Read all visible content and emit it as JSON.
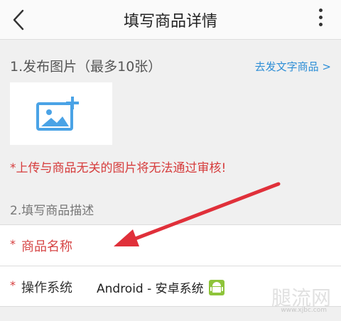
{
  "header": {
    "title": "填写商品详情"
  },
  "section_photos": {
    "label": "1.发布图片（最多10张）",
    "text_link": "去发文字商品 >",
    "warning": "*上传与商品无关的图片将无法通过审核!"
  },
  "section_description": {
    "label": "2.填写商品描述",
    "fields": [
      {
        "required_mark": "*",
        "label": "商品名称"
      },
      {
        "required_mark": "*",
        "label": "操作系统",
        "value": "Android - 安卓系统",
        "icon": "android-icon"
      }
    ]
  },
  "colors": {
    "accent_link": "#2d8ed6",
    "warning_red": "#d63c3c",
    "upload_icon": "#4aa3e6",
    "annotation_arrow": "#e0303a",
    "android_green": "#8ec43a"
  },
  "watermark": {
    "text": "腿流网",
    "sub": "www.xjbc.com"
  }
}
